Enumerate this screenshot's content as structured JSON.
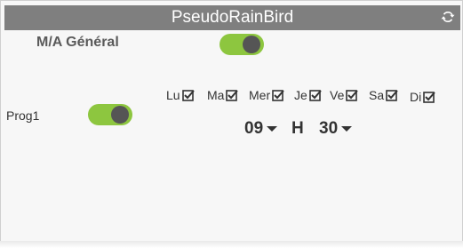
{
  "header": {
    "title": "PseudoRainBird",
    "refresh_icon": "refresh-icon"
  },
  "general": {
    "label": "M/A Général",
    "enabled": true
  },
  "program": {
    "label": "Prog1",
    "enabled": true,
    "days": [
      {
        "label": "Lu",
        "checked": true
      },
      {
        "label": "Ma",
        "checked": true
      },
      {
        "label": "Mer",
        "checked": true
      },
      {
        "label": "Je",
        "checked": true
      },
      {
        "label": "Ve",
        "checked": true
      },
      {
        "label": "Sa",
        "checked": true
      },
      {
        "label": "Di",
        "checked": true
      }
    ],
    "hour": "09",
    "hour_separator": "H",
    "minute": "30"
  },
  "colors": {
    "header_bg": "#7f7f7f",
    "toggle_on": "#8dc63f",
    "knob": "#555555"
  }
}
